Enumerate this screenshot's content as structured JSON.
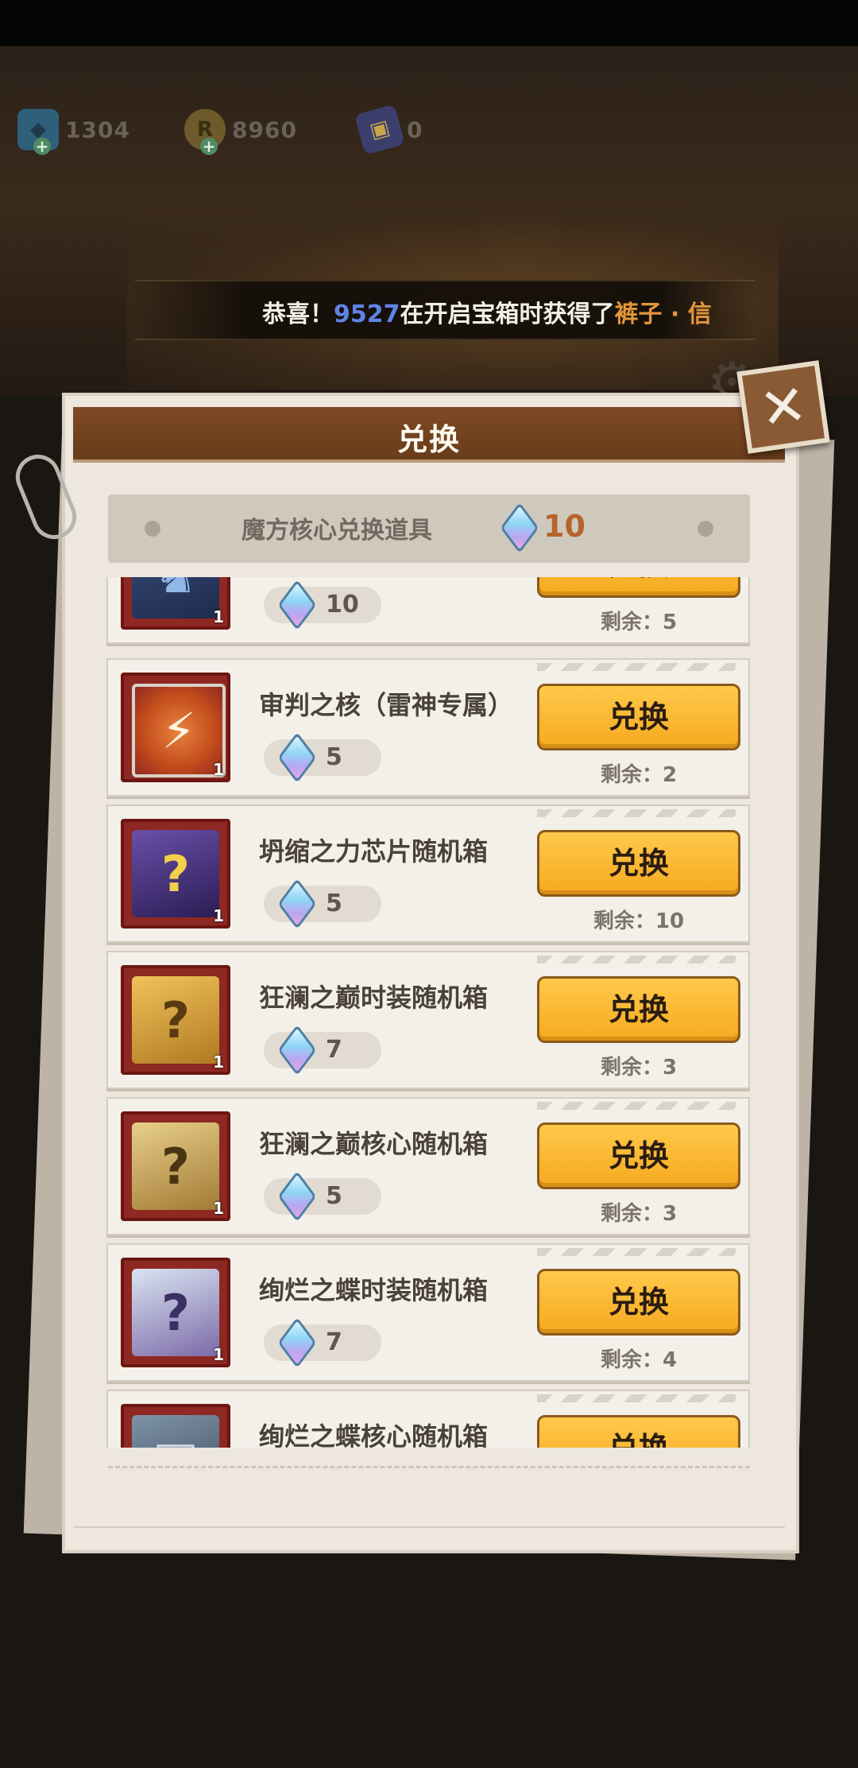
{
  "resources": [
    {
      "icon": "gem-icon",
      "value": "1304"
    },
    {
      "icon": "coin-icon",
      "value": "8960"
    },
    {
      "icon": "ticket-icon",
      "value": "0"
    }
  ],
  "ticker": {
    "prefix": "恭喜！",
    "uid": "9527",
    "middle": "在开启宝箱时获得了",
    "item": "裤子 · 信"
  },
  "panel": {
    "title": "兑换",
    "sub_label": "魔方核心兑换道具",
    "balance": "10"
  },
  "items": [
    {
      "name": "",
      "cost": "10",
      "button": "兑换",
      "remaining": "剩余：5",
      "qty": "1",
      "icon": "mech-robot-icon"
    },
    {
      "name": "审判之核（雷神专属）",
      "cost": "5",
      "button": "兑换",
      "remaining": "剩余：2",
      "qty": "1",
      "icon": "thunder-core-icon"
    },
    {
      "name": "坍缩之力芯片随机箱",
      "cost": "5",
      "button": "兑换",
      "remaining": "剩余：10",
      "qty": "1",
      "icon": "purple-mystery-box-icon"
    },
    {
      "name": "狂澜之巅时装随机箱",
      "cost": "7",
      "button": "兑换",
      "remaining": "剩余：3",
      "qty": "1",
      "icon": "gold-mystery-box-icon"
    },
    {
      "name": "狂澜之巅核心随机箱",
      "cost": "5",
      "button": "兑换",
      "remaining": "剩余：3",
      "qty": "1",
      "icon": "gold-chest-icon"
    },
    {
      "name": "绚烂之蝶时装随机箱",
      "cost": "7",
      "button": "兑换",
      "remaining": "剩余：4",
      "qty": "1",
      "icon": "butterfly-box-icon"
    },
    {
      "name": "绚烂之蝶核心随机箱",
      "cost": "",
      "button": "兑换",
      "remaining": "",
      "qty": "",
      "icon": "steel-box-icon"
    }
  ]
}
